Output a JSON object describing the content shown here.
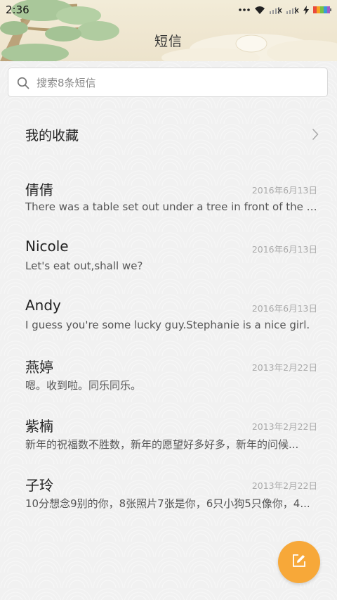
{
  "status_bar": {
    "time": "2:36",
    "icons": [
      "more-dots-icon",
      "wifi-icon",
      "signal-icon",
      "signal-icon",
      "charging-icon",
      "battery-icon"
    ]
  },
  "header": {
    "title": "短信"
  },
  "search": {
    "placeholder": "搜索8条短信"
  },
  "favorites": {
    "label": "我的收藏"
  },
  "conversations": [
    {
      "name": "倩倩",
      "date": "2016年6月13日",
      "preview": "There was a table set out under a tree in front of the ho..."
    },
    {
      "name": "Nicole",
      "date": "2016年6月13日",
      "preview": "Let's eat out,shall we?"
    },
    {
      "name": "Andy",
      "date": "2016年6月13日",
      "preview": "I guess you're some lucky guy.Stephanie is a nice girl."
    },
    {
      "name": "燕婷",
      "date": "2013年2月22日",
      "preview": "嗯。收到啦。同乐同乐。"
    },
    {
      "name": "紫楠",
      "date": "2013年2月22日",
      "preview": "新年的祝福数不胜数，新年的愿望好多好多，新年的问候..."
    },
    {
      "name": "子玲",
      "date": "2013年2月22日",
      "preview": "10分想念9别的你，8张照片7张是你，6只小狗5只像你，4..."
    }
  ],
  "compose": {
    "icon": "compose-icon"
  },
  "colors": {
    "accent": "#f7a839",
    "background": "#f1f1f1",
    "date": "#aaaaaa"
  }
}
